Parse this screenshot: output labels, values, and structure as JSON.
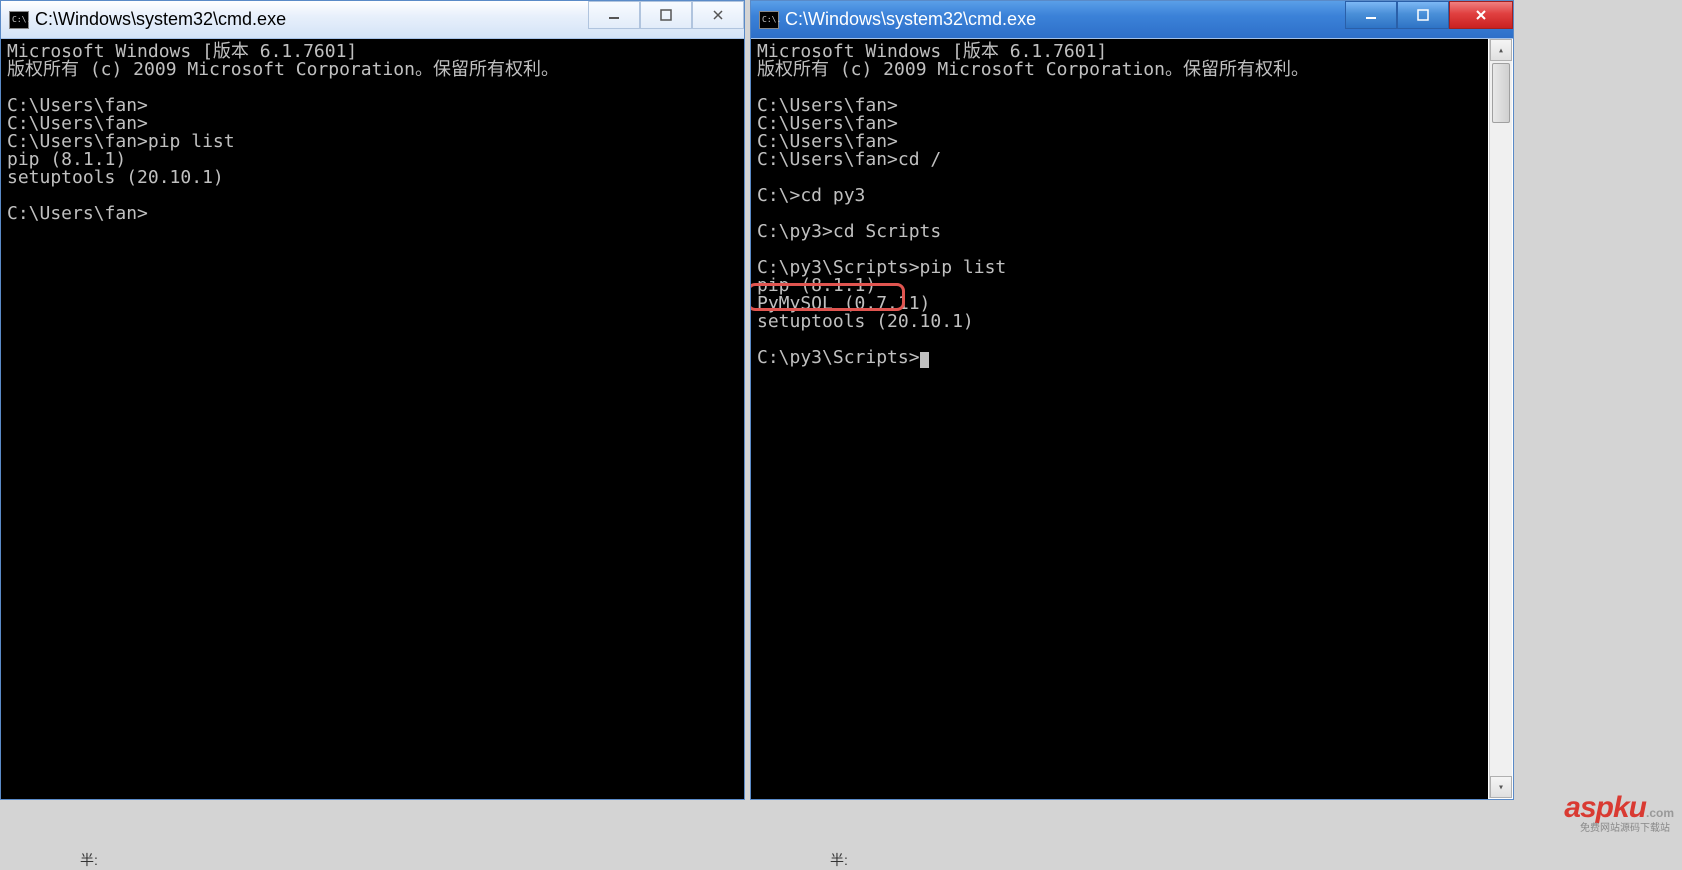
{
  "left_window": {
    "title": "C:\\Windows\\system32\\cmd.exe",
    "icon_text": "C:\\.",
    "lines": [
      "Microsoft Windows [版本 6.1.7601]",
      "版权所有 (c) 2009 Microsoft Corporation。保留所有权利。",
      "",
      "C:\\Users\\fan>",
      "C:\\Users\\fan>",
      "C:\\Users\\fan>pip list",
      "pip (8.1.1)",
      "setuptools (20.10.1)",
      "",
      "C:\\Users\\fan>"
    ]
  },
  "right_window": {
    "title": "C:\\Windows\\system32\\cmd.exe",
    "icon_text": "C:\\.",
    "lines": [
      "Microsoft Windows [版本 6.1.7601]",
      "版权所有 (c) 2009 Microsoft Corporation。保留所有权利。",
      "",
      "C:\\Users\\fan>",
      "C:\\Users\\fan>",
      "C:\\Users\\fan>",
      "C:\\Users\\fan>cd /",
      "",
      "C:\\>cd py3",
      "",
      "C:\\py3>cd Scripts",
      "",
      "C:\\py3\\Scripts>pip list",
      "pip (8.1.1)",
      "PyMySQL (0.7.11)",
      "setuptools (20.10.1)",
      "",
      "C:\\py3\\Scripts>"
    ],
    "highlighted_line_index": 14
  },
  "watermark": {
    "text": "aspku",
    "suffix": ".com",
    "sub": "免费网站源码下载站"
  },
  "grip_text": "半:"
}
